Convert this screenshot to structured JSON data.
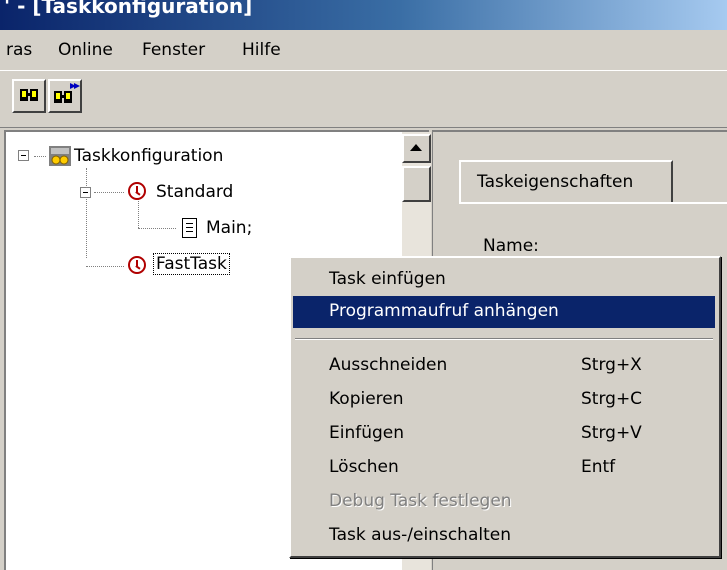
{
  "window": {
    "title": "' - [Taskkonfiguration]"
  },
  "menubar": {
    "items": [
      "ras",
      "Online",
      "Fenster",
      "Hilfe"
    ]
  },
  "toolbar": {
    "buttons": [
      "find-icon",
      "find-next-icon"
    ]
  },
  "tree": {
    "root": "Taskkonfiguration",
    "standard": "Standard",
    "main": "Main;",
    "fasttask": "FastTask"
  },
  "properties": {
    "tab_label": "Taskeigenschaften",
    "name_label": "Name:"
  },
  "context_menu": {
    "items": [
      {
        "label": "Task einfügen",
        "shortcut": ""
      },
      {
        "label": "Programmaufruf anhängen",
        "shortcut": ""
      },
      {
        "label": "Ausschneiden",
        "shortcut": "Strg+X"
      },
      {
        "label": "Kopieren",
        "shortcut": "Strg+C"
      },
      {
        "label": "Einfügen",
        "shortcut": "Strg+V"
      },
      {
        "label": "Löschen",
        "shortcut": "Entf"
      },
      {
        "label": "Debug Task festlegen",
        "shortcut": ""
      },
      {
        "label": "Task aus-/einschalten",
        "shortcut": ""
      }
    ],
    "highlighted_index": 1,
    "disabled_index": 6
  },
  "colors": {
    "highlight": "#0a246a",
    "face": "#d4d0c8",
    "title_gradient_start": "#0a246a"
  }
}
